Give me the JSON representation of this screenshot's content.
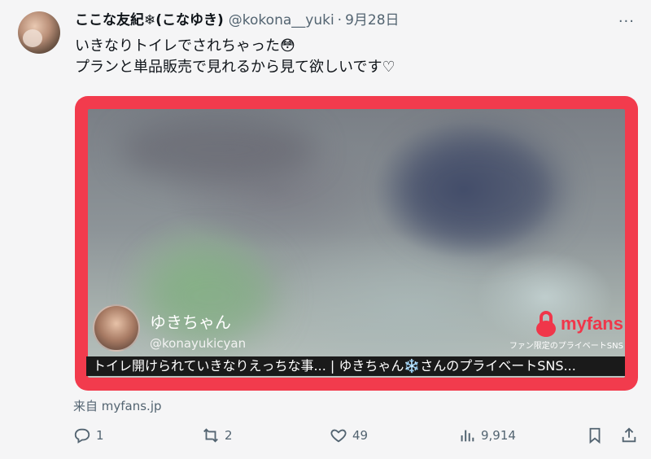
{
  "tweet": {
    "display_name": "ここな友紀❄(こなゆき)",
    "handle": "@kokona__yuki",
    "separator": "·",
    "time": "9月28日",
    "more": "···",
    "text_lines": [
      "いきなりトイレでされちゃった😳",
      "プランと単品販売で見れるから見て欲しいです♡"
    ]
  },
  "card": {
    "creator_name": "ゆきちゃん",
    "creator_handle": "@konayukicyan",
    "brand_name": "myfans",
    "brand_tagline": "ファン限定のプライベートSNS",
    "caption": "トイレ開けられていきなりえっちな事... | ゆきちゃん❄️さんのプライベートSNS...",
    "border_color": "#f23b4d",
    "brand_color": "#f0364a"
  },
  "source": "来自 myfans.jp",
  "actions": {
    "reply_count": "1",
    "retweet_count": "2",
    "like_count": "49",
    "views_count": "9,914",
    "icons": [
      "reply-icon",
      "retweet-icon",
      "like-icon",
      "views-icon",
      "bookmark-icon",
      "share-icon"
    ]
  }
}
